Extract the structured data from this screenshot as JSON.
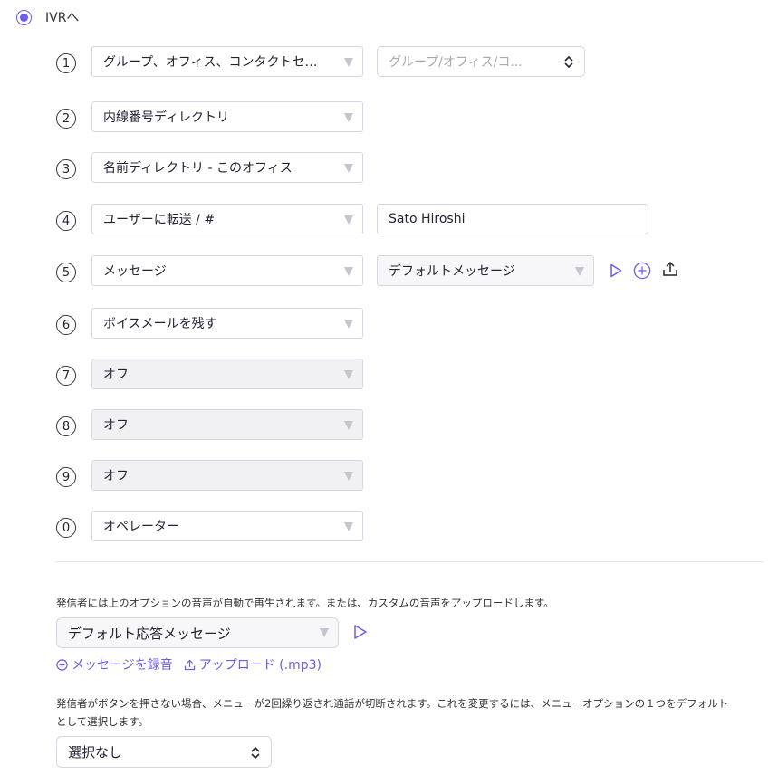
{
  "route": {
    "label": "IVRへ",
    "selected": true
  },
  "keys": [
    {
      "num": "1",
      "action": "グループ、オフィス、コンタクトセンター",
      "side": "select",
      "side_placeholder": "グループ/オフィス/コ..."
    },
    {
      "num": "2",
      "action": "内線番号ディレクトリ"
    },
    {
      "num": "3",
      "action": "名前ディレクトリ - このオフィス"
    },
    {
      "num": "4",
      "action": "ユーザーに転送 / #",
      "side": "input",
      "side_value": "Sato Hiroshi"
    },
    {
      "num": "5",
      "action": "メッセージ",
      "side": "message",
      "side_value": "デフォルトメッセージ"
    },
    {
      "num": "6",
      "action": "ボイスメールを残す"
    },
    {
      "num": "7",
      "action": "オフ",
      "off": true
    },
    {
      "num": "8",
      "action": "オフ",
      "off": true
    },
    {
      "num": "9",
      "action": "オフ",
      "off": true
    },
    {
      "num": "0",
      "action": "オペレーター"
    }
  ],
  "greeting": {
    "note": "発信者には上のオプションの音声が自動で再生されます。または、カスタムの音声をアップロードします。",
    "selected": "デフォルト応答メッセージ",
    "record_label": "メッセージを録音",
    "upload_label": "アップロード (.mp3)"
  },
  "timeout": {
    "note_line1": "発信者がボタンを押さない場合、メニューが2回繰り返され通話が切断されます。これを変更するには、メニューオプションの１つをデフォルト",
    "note_line2": "として選択します。",
    "selected": "選択なし"
  },
  "colors": {
    "accent": "#6d5ce7",
    "border": "#d6d6e0",
    "disabled_bg": "#f1f1f3"
  },
  "icons": {
    "play": "play-icon",
    "add": "plus-circle-icon",
    "upload": "upload-icon"
  }
}
